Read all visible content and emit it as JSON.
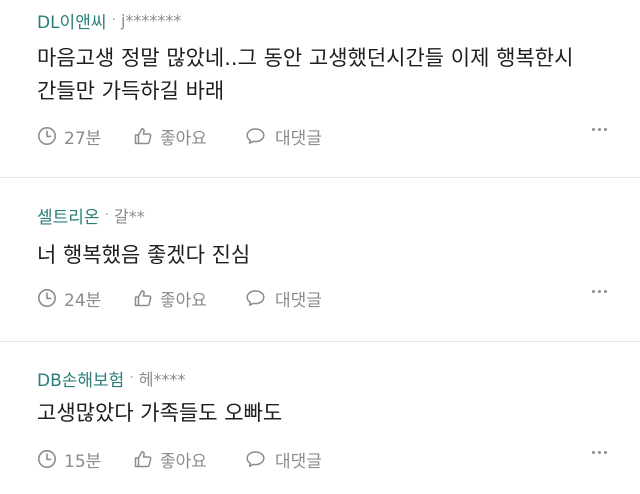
{
  "comments": [
    {
      "author": "DL이앤씨",
      "separator": "·",
      "user": "j*******",
      "text_lines": [
        "마음고생 정말 많았네..그 동안 고생했던시간들 이제 행복한시",
        "간들만 가득하길 바래"
      ],
      "time": "27분",
      "like_label": "좋아요",
      "reply_label": "대댓글"
    },
    {
      "author": "셀트리온",
      "separator": "·",
      "user": "갈**",
      "text_lines": [
        "너 행복했음 좋겠다 진심"
      ],
      "time": "24분",
      "like_label": "좋아요",
      "reply_label": "대댓글"
    },
    {
      "author": "DB손해보험",
      "separator": "·",
      "user": "헤****",
      "text_lines": [
        "고생많았다 가족들도 오빠도"
      ],
      "time": "15분",
      "like_label": "좋아요",
      "reply_label": "대댓글"
    }
  ],
  "icons": {
    "time": "clock-icon",
    "like": "thumbs-up-icon",
    "reply": "speech-bubble-icon",
    "more": "more-dots-icon"
  },
  "colors": {
    "author": "#2a7e7a",
    "meta": "#8c8c8c",
    "text": "#1e1e1e",
    "divider": "#e6e6e6"
  }
}
